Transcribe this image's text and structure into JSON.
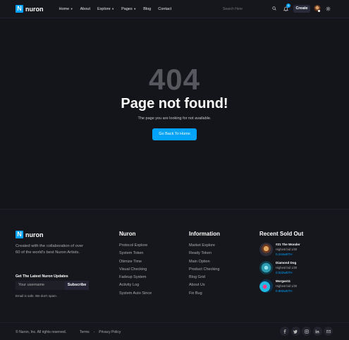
{
  "header": {
    "logo_mark": "N",
    "logo_text": "nuron",
    "nav": [
      {
        "label": "Home",
        "dropdown": true
      },
      {
        "label": "About",
        "dropdown": false
      },
      {
        "label": "Explore",
        "dropdown": true
      },
      {
        "label": "Pages",
        "dropdown": true
      },
      {
        "label": "Blog",
        "dropdown": false
      },
      {
        "label": "Contact",
        "dropdown": false
      }
    ],
    "search_placeholder": "Search Here",
    "notification_count": "6",
    "create_label": "Create",
    "icons": {
      "search": "search-icon",
      "bell": "bell-icon",
      "theme": "sun-icon"
    }
  },
  "error": {
    "code": "404",
    "title": "Page not found!",
    "description": "The page you are looking for not available.",
    "button": "Go Back To Home"
  },
  "footer": {
    "about": "Created with the collaboration of over 60 of the world's best Nuron Artists.",
    "subscribe_title": "Get The Latest Nuron Updates",
    "subscribe_placeholder": "Your username",
    "subscribe_button": "Subscribe",
    "subscribe_note": "Email is safe. We don't spam.",
    "columns": [
      {
        "title": "Nuron",
        "links": [
          "Protocol Explore",
          "System Token",
          "Otimize Time",
          "Visual Checking",
          "Fadeup System",
          "Activity Log",
          "System Auto Since"
        ]
      },
      {
        "title": "Information",
        "links": [
          "Market Explore",
          "Ready Token",
          "Main Option",
          "Product Checking",
          "Blog Grid",
          "About Us",
          "Fix Bug"
        ]
      }
    ],
    "recent_title": "Recent Sold Out",
    "recent": [
      {
        "name": "#21 The Wonder",
        "bid": "Highest bid 1/20",
        "price": "0.244wETH",
        "icon": "wonder-nft-thumbnail"
      },
      {
        "name": "Diamond Dog",
        "bid": "Highest bid 1/20",
        "price": "0.022wETH",
        "icon": "diamond-dog-nft-thumbnail"
      },
      {
        "name": "Morgan11",
        "bid": "Highest bid 1/20",
        "price": "0.892wETH",
        "icon": "morgan-nft-thumbnail"
      }
    ],
    "copyright": "© Nuron, Inc. All rights reserved.",
    "legal": [
      "Terms",
      "-",
      "Privacy Policy"
    ],
    "socials": [
      "facebook-icon",
      "twitter-icon",
      "instagram-icon",
      "linkedin-icon",
      "email-icon"
    ]
  },
  "colors": {
    "accent": "#00a3ff",
    "background": "#16161d",
    "muted": "#acacac"
  }
}
